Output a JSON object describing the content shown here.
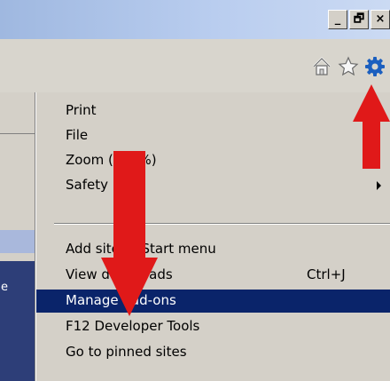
{
  "window": {
    "buttons": [
      {
        "name": "minimize",
        "glyph": "_"
      },
      {
        "name": "restore",
        "glyph": "🗗"
      },
      {
        "name": "close",
        "glyph": "×"
      }
    ]
  },
  "toolbar": {
    "icons": [
      "home-icon",
      "favorites-star-icon",
      "tools-gear-icon"
    ],
    "accent": "#1b5fbf"
  },
  "page": {
    "fragment": "e"
  },
  "menu": {
    "items": [
      {
        "label": "Print",
        "shortcut": "",
        "selected": false
      },
      {
        "label": "File",
        "shortcut": "",
        "selected": false
      },
      {
        "label": "Zoom (100%)",
        "shortcut": "",
        "selected": false
      },
      {
        "label": "Safety",
        "shortcut": "",
        "selected": false,
        "submenu": true
      },
      {
        "label": "Add site to Start menu",
        "shortcut": "",
        "selected": false
      },
      {
        "label": "View downloads",
        "shortcut": "Ctrl+J",
        "selected": false
      },
      {
        "label": "Manage add-ons",
        "shortcut": "",
        "selected": true
      },
      {
        "label": "F12 Developer Tools",
        "shortcut": "",
        "selected": false
      },
      {
        "label": "Go to pinned sites",
        "shortcut": "",
        "selected": false
      }
    ],
    "selection_color": "#0a246a"
  },
  "annotations": {
    "arrow_color": "#e01919"
  }
}
